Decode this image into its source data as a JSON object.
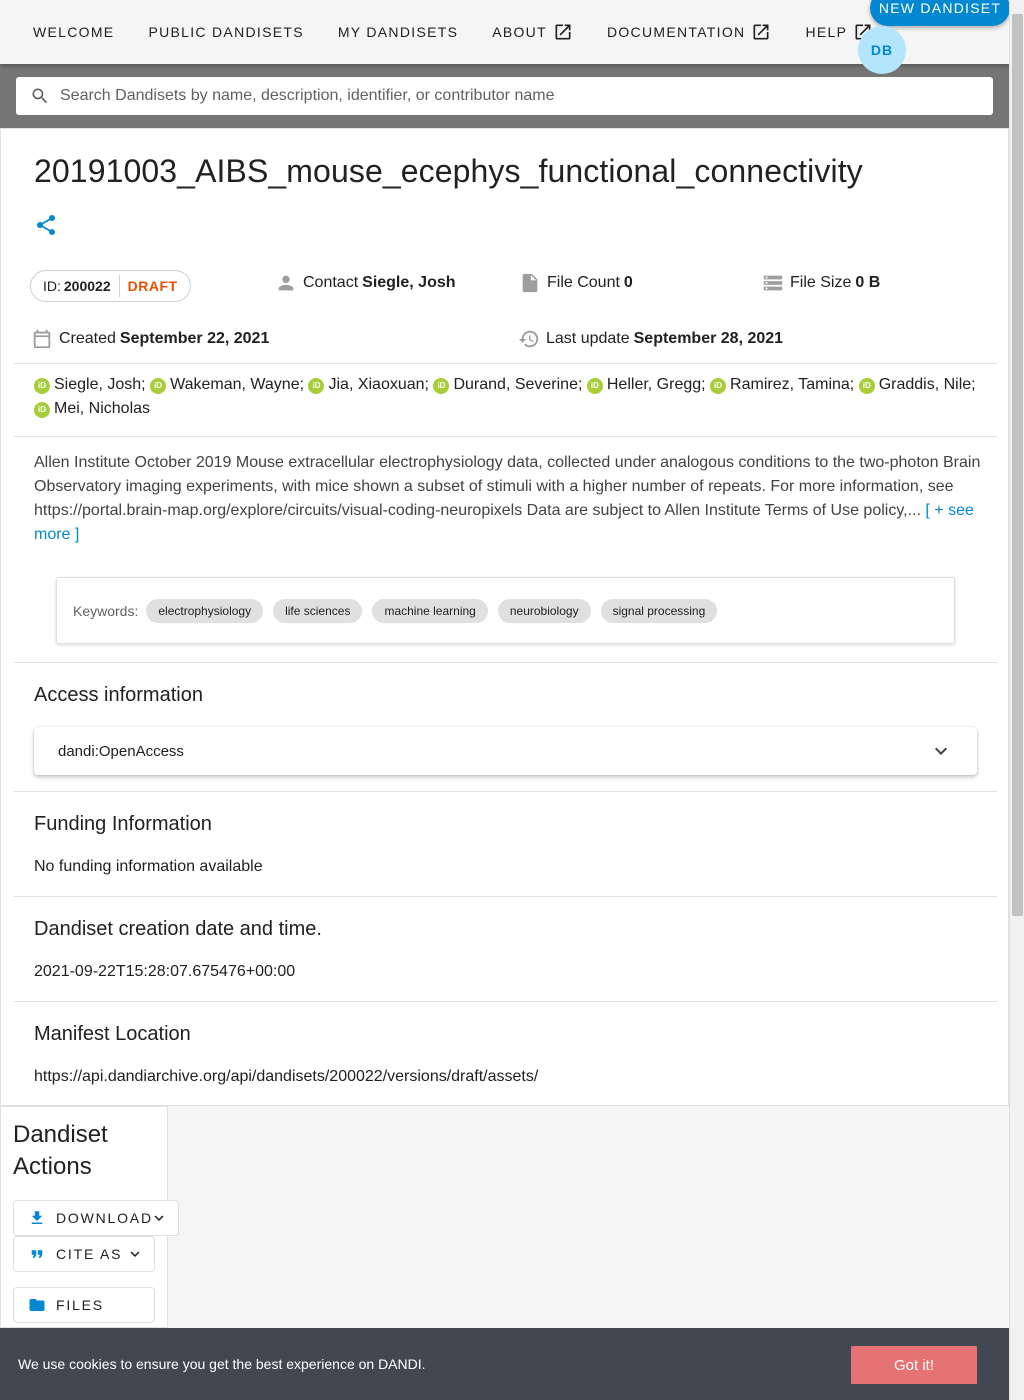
{
  "nav": {
    "items": [
      {
        "label": "WELCOME",
        "external": false
      },
      {
        "label": "PUBLIC DANDISETS",
        "external": false
      },
      {
        "label": "MY DANDISETS",
        "external": false
      },
      {
        "label": "ABOUT",
        "external": true
      },
      {
        "label": "DOCUMENTATION",
        "external": true
      },
      {
        "label": "HELP",
        "external": true
      }
    ],
    "new_dandiset": "NEW DANDISET",
    "avatar_initials": "DB"
  },
  "search": {
    "placeholder": "Search Dandisets by name, description, identifier, or contributor name"
  },
  "dandiset": {
    "title": "20191003_AIBS_mouse_ecephys_functional_connectivity",
    "id_label": "ID:",
    "id": "200022",
    "status": "DRAFT",
    "contact_label": "Contact",
    "contact": "Siegle, Josh",
    "file_count_label": "File Count",
    "file_count": "0",
    "file_size_label": "File Size",
    "file_size": "0 B",
    "created_label": "Created",
    "created": "September 22, 2021",
    "updated_label": "Last update",
    "updated": "September 28, 2021",
    "contributors": [
      "Siegle, Josh;",
      "Wakeman, Wayne;",
      "Jia, Xiaoxuan;",
      "Durand, Severine;",
      "Heller, Gregg;",
      "Ramirez, Tamina;",
      "Graddis, Nile;",
      "Mei, Nicholas"
    ],
    "description": "Allen Institute October 2019 Mouse extracellular electrophysiology data, collected under analogous conditions to the two-photon Brain Observatory imaging experiments, with mice shown a subset of stimuli with a higher number of repeats. For more information, see https://portal.brain-map.org/explore/circuits/visual-coding-neuropixels Data are subject to Allen Institute Terms of Use policy,...",
    "see_more": "[ + see more ]",
    "keywords_label": "Keywords:",
    "keywords": [
      "electrophysiology",
      "life sciences",
      "machine learning",
      "neurobiology",
      "signal processing"
    ]
  },
  "access": {
    "title": "Access information",
    "value": "dandi:OpenAccess"
  },
  "funding": {
    "title": "Funding Information",
    "text": "No funding information available"
  },
  "creation": {
    "title": "Dandiset creation date and time.",
    "text": "2021-09-22T15:28:07.675476+00:00"
  },
  "manifest": {
    "title": "Manifest Location",
    "text": "https://api.dandiarchive.org/api/dandisets/200022/versions/draft/assets/"
  },
  "actions": {
    "title": "Dandiset Actions",
    "download": "DOWNLOAD",
    "cite": "CITE AS",
    "files": "FILES"
  },
  "cookie": {
    "text": "We use cookies to ensure you get the best experience on DANDI.",
    "button": "Got it!"
  },
  "colors": {
    "primary": "#0288d1",
    "draft": "#e65100",
    "orcid": "#a6ce39",
    "cookie_bg": "#424851",
    "cookie_btn": "#e57373"
  }
}
